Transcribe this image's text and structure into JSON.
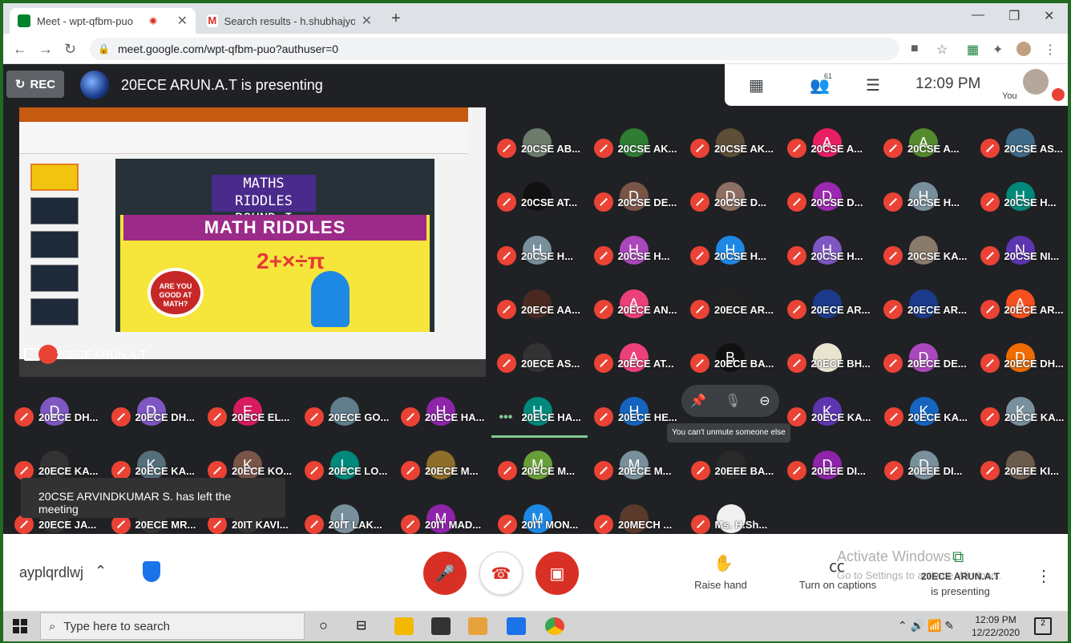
{
  "browser": {
    "tabs": [
      {
        "title": "Meet - wpt-qfbm-puo",
        "active": true
      },
      {
        "title": "Search results - h.shubhajyothi@",
        "active": false
      }
    ],
    "url": "meet.google.com/wpt-qfbm-puo?authuser=0"
  },
  "meet": {
    "rec_label": "REC",
    "presenting_text": "20ECE ARUN.A.T is presenting",
    "participant_count": "61",
    "time": "12:09 PM",
    "you_label": "You",
    "share_label": "20ECE ARUN.A.T",
    "slide": {
      "title": "MATHS RIDDLES ROUND I",
      "banner": "MATH RIDDLES",
      "badge": "ARE YOU GOOD AT MATH?"
    },
    "tooltip": "You can't unmute someone else",
    "toast": "20CSE ARVINDKUMAR S. has left the meeting",
    "participants": [
      {
        "name": "20CSE AB...",
        "initial": "",
        "color": "#6d7b6b"
      },
      {
        "name": "20CSE AK...",
        "initial": "",
        "color": "#2e7d32"
      },
      {
        "name": "20CSE AK...",
        "initial": "",
        "color": "#5d4e37"
      },
      {
        "name": "20CSE A...",
        "initial": "A",
        "color": "#e91e63"
      },
      {
        "name": "20CSE A...",
        "initial": "A",
        "color": "#558b2f"
      },
      {
        "name": "20CSE AS...",
        "initial": "",
        "color": "#3f6b8a"
      },
      {
        "name": "20CSE AT...",
        "initial": "",
        "color": "#111111"
      },
      {
        "name": "20CSE DE...",
        "initial": "D",
        "color": "#795548"
      },
      {
        "name": "20CSE D...",
        "initial": "D",
        "color": "#8d6e63"
      },
      {
        "name": "20CSE D...",
        "initial": "D",
        "color": "#9c27b0"
      },
      {
        "name": "20CSE H...",
        "initial": "H",
        "color": "#78909c"
      },
      {
        "name": "20CSE H...",
        "initial": "H",
        "color": "#00897b"
      },
      {
        "name": "20CSE H...",
        "initial": "H",
        "color": "#78909c"
      },
      {
        "name": "20CSE H...",
        "initial": "H",
        "color": "#ab47bc"
      },
      {
        "name": "20CSE H...",
        "initial": "H",
        "color": "#1e88e5"
      },
      {
        "name": "20CSE H...",
        "initial": "H",
        "color": "#7e57c2"
      },
      {
        "name": "20CSE KA...",
        "initial": "",
        "color": "#8a7a6a"
      },
      {
        "name": "20CSE NI...",
        "initial": "N",
        "color": "#5e35b1"
      },
      {
        "name": "20ECE AA...",
        "initial": "",
        "color": "#4a2a20"
      },
      {
        "name": "20ECE AN...",
        "initial": "A",
        "color": "#ec407a"
      },
      {
        "name": "20ECE AR...",
        "initial": "",
        "color": "#222222"
      },
      {
        "name": "20ECE AR...",
        "initial": "",
        "color": "#1b3a8a"
      },
      {
        "name": "20ECE AR...",
        "initial": "",
        "color": "#1b3a8a"
      },
      {
        "name": "20ECE AR...",
        "initial": "A",
        "color": "#f4511e"
      },
      {
        "name": "20ECE AS...",
        "initial": "",
        "color": "#333333"
      },
      {
        "name": "20ECE AT...",
        "initial": "A",
        "color": "#ec407a"
      },
      {
        "name": "20ECE BA...",
        "initial": "B",
        "color": "#111111"
      },
      {
        "name": "20ECE BH...",
        "initial": "",
        "color": "#e8e4d0"
      },
      {
        "name": "20ECE DE...",
        "initial": "D",
        "color": "#ab47bc"
      },
      {
        "name": "20ECE DH...",
        "initial": "D",
        "color": "#ef6c00"
      },
      {
        "name": "20ECE DH...",
        "initial": "D",
        "color": "#7e57c2"
      },
      {
        "name": "20ECE DH...",
        "initial": "D",
        "color": "#7e57c2"
      },
      {
        "name": "20ECE EL...",
        "initial": "E",
        "color": "#d81b60"
      },
      {
        "name": "20ECE GO...",
        "initial": "",
        "color": "#607d8b"
      },
      {
        "name": "20ECE HA...",
        "initial": "H",
        "color": "#8e24aa"
      },
      {
        "name": "20ECE HA...",
        "initial": "H",
        "color": "#00897b"
      },
      {
        "name": "20ECE HE...",
        "initial": "H",
        "color": "#1565c0"
      },
      {
        "name": "",
        "initial": "",
        "color": "#3c4043"
      },
      {
        "name": "20ECE KA...",
        "initial": "K",
        "color": "#5e35b1"
      },
      {
        "name": "20ECE KA...",
        "initial": "K",
        "color": "#1565c0"
      },
      {
        "name": "20ECE KA...",
        "initial": "K",
        "color": "#78909c"
      },
      {
        "name": "20ECE KA...",
        "initial": "",
        "color": "#333333"
      },
      {
        "name": "20ECE KA...",
        "initial": "K",
        "color": "#546e7a"
      },
      {
        "name": "20ECE KO...",
        "initial": "K",
        "color": "#795548"
      },
      {
        "name": "20ECE LO...",
        "initial": "L",
        "color": "#00897b"
      },
      {
        "name": "20ECE M...",
        "initial": "",
        "color": "#8d6e2a"
      },
      {
        "name": "20ECE M...",
        "initial": "M",
        "color": "#689f38"
      },
      {
        "name": "20ECE M...",
        "initial": "M",
        "color": "#78909c"
      },
      {
        "name": "20EEE BA...",
        "initial": "",
        "color": "#2a2a2a"
      },
      {
        "name": "20EEE DI...",
        "initial": "D",
        "color": "#8e24aa"
      },
      {
        "name": "20EEE DI...",
        "initial": "D",
        "color": "#78909c"
      },
      {
        "name": "20EEE KI...",
        "initial": "",
        "color": "#6b5b4b"
      },
      {
        "name": "20ECE JA...",
        "initial": "",
        "color": "#333333"
      },
      {
        "name": "20ECE MR...",
        "initial": "",
        "color": "#333333"
      },
      {
        "name": "20IT KAVI...",
        "initial": "",
        "color": "#333333"
      },
      {
        "name": "20IT LAK...",
        "initial": "L",
        "color": "#78909c"
      },
      {
        "name": "20IT MAD...",
        "initial": "M",
        "color": "#8e24aa"
      },
      {
        "name": "20IT MON...",
        "initial": "M",
        "color": "#1e88e5"
      },
      {
        "name": "20MECH ...",
        "initial": "",
        "color": "#5a3a2a"
      },
      {
        "name": "Ms. H.Sh...",
        "initial": "",
        "color": "#f0f0f0"
      }
    ]
  },
  "controls": {
    "meeting_code": "ayplqrdlwj",
    "raise_hand": "Raise hand",
    "captions": "Turn on captions",
    "presenting_name": "20ECE ARUN.A.T",
    "presenting_sub": "is presenting",
    "watermark_title": "Activate Windows",
    "watermark_sub": "Go to Settings to activate Windows."
  },
  "taskbar": {
    "search_placeholder": "Type here to search",
    "time": "12:09 PM",
    "date": "12/22/2020",
    "notifications": "2"
  }
}
